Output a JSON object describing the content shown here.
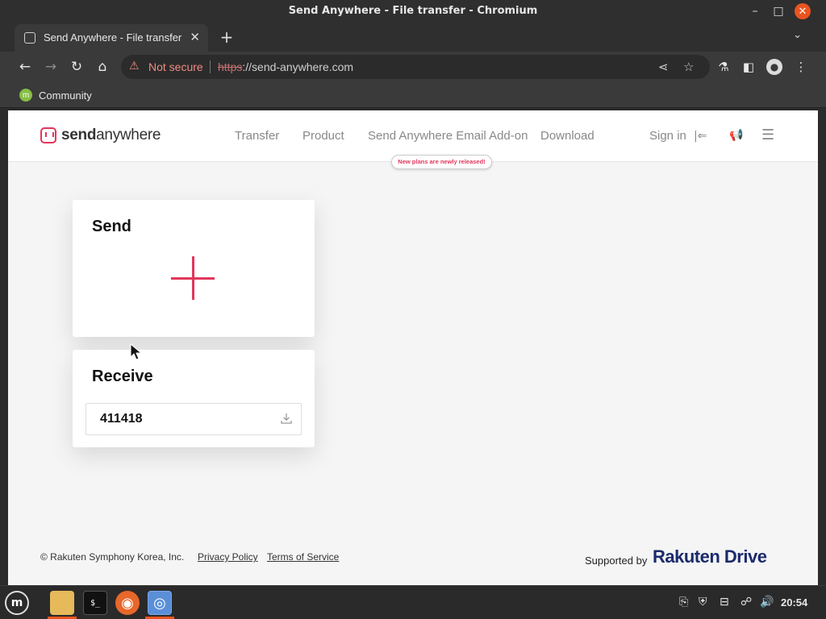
{
  "window": {
    "title": "Send Anywhere - File transfer - Chromium",
    "minimize_glyph": "–",
    "maximize_glyph": "□",
    "close_glyph": "✕"
  },
  "tabs": [
    {
      "title": "Send Anywhere - File transfer",
      "close_glyph": "✕",
      "active": true
    }
  ],
  "tabstrip": {
    "new_tab_glyph": "+",
    "tab_menu_glyph": "⌄"
  },
  "toolbar": {
    "back_glyph": "←",
    "forward_glyph": "→",
    "reload_glyph": "↻",
    "home_glyph": "⌂",
    "security_warning_glyph": "⚠",
    "security_label": "Not secure",
    "url_scheme": "https",
    "url_rest": "://send-anywhere.com",
    "share_glyph": "⋖",
    "bookmark_star_glyph": "☆",
    "extensions_glyph": "⚗",
    "sidepanel_glyph": "◧",
    "profile_glyph": "●",
    "menu_glyph": "⋮"
  },
  "bookmarks": [
    {
      "label": "Community",
      "icon": "linux-mint-icon",
      "glyph": "m"
    }
  ],
  "site": {
    "logo": {
      "bold": "send",
      "light": "anywhere"
    },
    "nav": [
      {
        "label": "Transfer"
      },
      {
        "label": "Product"
      },
      {
        "label": "Send Anywhere Email Add-on"
      },
      {
        "label": "Download"
      }
    ],
    "new_badge": "New plans are newly released!",
    "sign_in": "Sign in",
    "sign_in_glyph": "|⇐",
    "announce_glyph": "📢",
    "menu_glyph": "☰",
    "accent_color": "#e2365b"
  },
  "send_card": {
    "title": "Send"
  },
  "receive_card": {
    "title": "Receive",
    "key_value": "411418"
  },
  "footer": {
    "copyright": "© Rakuten Symphony Korea, Inc.",
    "privacy": "Privacy Policy",
    "terms": "Terms of Service",
    "supported_by": "Supported by",
    "brand_part1": "Rakuten ",
    "brand_part2": "Drive"
  },
  "taskbar": {
    "apps": [
      {
        "name": "menu",
        "glyph": "m"
      },
      {
        "name": "files",
        "glyph": "▬"
      },
      {
        "name": "terminal",
        "glyph": "$_"
      },
      {
        "name": "firefox",
        "glyph": "◉"
      },
      {
        "name": "chromium",
        "glyph": "◎"
      }
    ],
    "tray": [
      {
        "name": "clipboard",
        "glyph": "⎘"
      },
      {
        "name": "shield",
        "glyph": "⛨"
      },
      {
        "name": "updates",
        "glyph": "⊟"
      },
      {
        "name": "network",
        "glyph": "☍"
      },
      {
        "name": "volume",
        "glyph": "🔊"
      }
    ],
    "clock": "20:54"
  }
}
